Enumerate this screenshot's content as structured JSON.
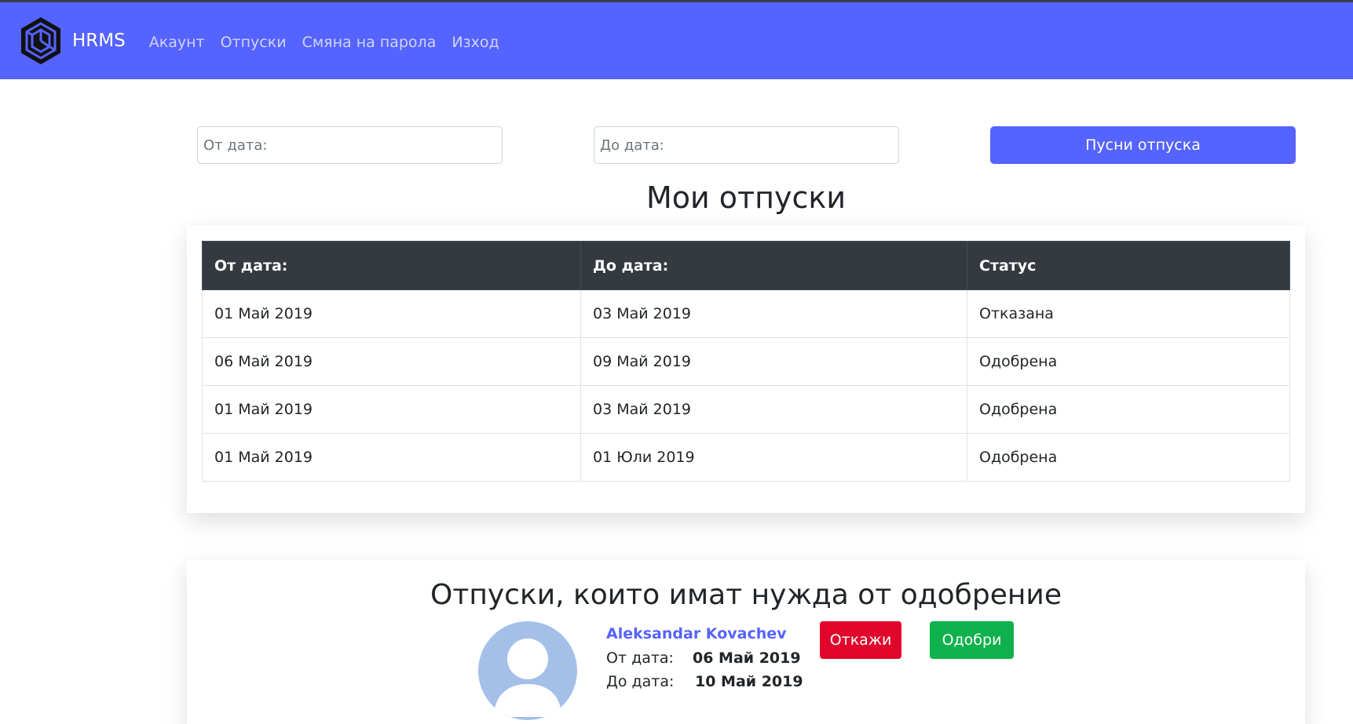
{
  "navbar": {
    "brand": "HRMS",
    "links": [
      "Акаунт",
      "Отпуски",
      "Смяна на парола",
      "Изход"
    ]
  },
  "request_form": {
    "from_placeholder": "От дата:",
    "to_placeholder": "До дата:",
    "submit_label": "Пусни отпуска"
  },
  "my_leaves": {
    "title": "Мои отпуски",
    "columns": [
      "От дата:",
      "До дата:",
      "Статус"
    ],
    "rows": [
      [
        "01 Май 2019",
        "03 Май 2019",
        "Отказана"
      ],
      [
        "06 Май 2019",
        "09 Май 2019",
        "Одобрена"
      ],
      [
        "01 Май 2019",
        "03 Май 2019",
        "Одобрена"
      ],
      [
        "01 Май 2019",
        "01 Юли 2019",
        "Одобрена"
      ]
    ]
  },
  "pending": {
    "title": "Отпуски, които имат нужда от одобрение",
    "items": [
      {
        "name": "Aleksandar Kovachev",
        "from_label": "От дата:",
        "from_value": "06 Май 2019",
        "to_label": "До дата:",
        "to_value": "10 Май 2019",
        "reject_label": "Откажи",
        "approve_label": "Одобри"
      }
    ]
  },
  "colors": {
    "primary": "#5563ff",
    "table_header": "#343a40",
    "danger": "#e0062b",
    "success": "#0eb14b",
    "avatar_bg": "#a4c0e8"
  },
  "icons": [
    "hrms-logo-icon",
    "user-avatar-icon"
  ]
}
